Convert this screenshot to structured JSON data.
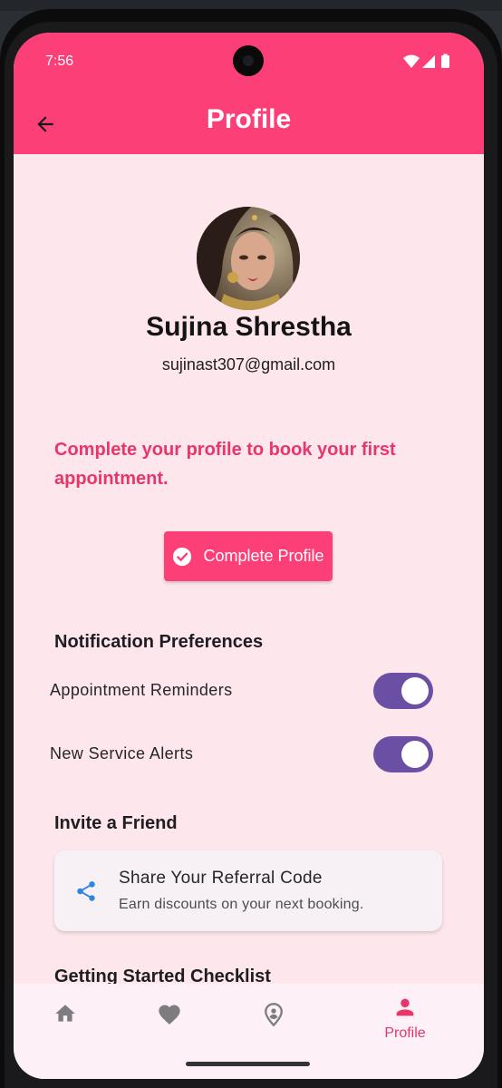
{
  "status_bar": {
    "time": "7:56"
  },
  "header": {
    "title": "Profile"
  },
  "profile": {
    "name": "Sujina Shrestha",
    "email": "sujinast307@gmail.com"
  },
  "completion": {
    "message": "Complete your profile to book your first appointment.",
    "button_label": "Complete Profile"
  },
  "notifications": {
    "title": "Notification Preferences",
    "items": [
      {
        "label": "Appointment Reminders",
        "enabled": true
      },
      {
        "label": "New Service Alerts",
        "enabled": true
      }
    ]
  },
  "invite": {
    "title": "Invite a Friend",
    "card_title": "Share Your Referral Code",
    "card_subtitle": "Earn discounts on your next booking."
  },
  "checklist": {
    "title": "Getting Started Checklist"
  },
  "bottom_nav": {
    "items": [
      {
        "icon": "home-icon",
        "label": ""
      },
      {
        "icon": "heart-icon",
        "label": ""
      },
      {
        "icon": "location-person-icon",
        "label": ""
      },
      {
        "icon": "person-icon",
        "label": "Profile",
        "active": true
      }
    ]
  },
  "colors": {
    "primary": "#fd3f78",
    "background": "#fde6ec",
    "switch_track": "#6a4fa4",
    "accent_text": "#e8366a",
    "share_icon": "#2f86de"
  }
}
